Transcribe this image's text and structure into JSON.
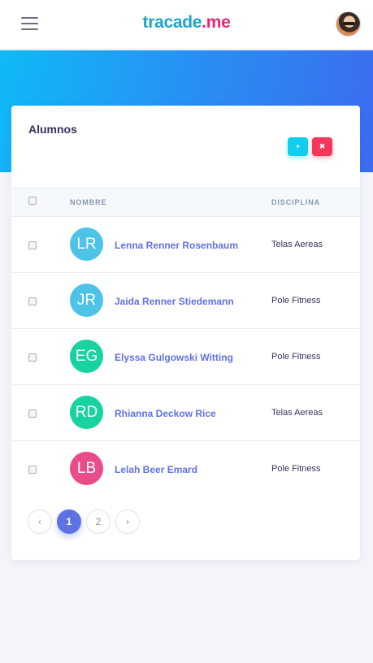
{
  "header": {
    "brand_part1": "tracade",
    "brand_part2": ".me"
  },
  "card": {
    "title": "Alumnos",
    "add_label": "+",
    "delete_label": "✖"
  },
  "table": {
    "columns": [
      "NOMBRE",
      "DISCIPLINA"
    ],
    "rows": [
      {
        "initials": "LR",
        "name": "Lenna Renner Rosenbaum",
        "discipline": "Telas Aereas",
        "color": "#4ec3e8"
      },
      {
        "initials": "JR",
        "name": "Jaida Renner Stiedemann",
        "discipline": "Pole Fitness",
        "color": "#4ec3e8"
      },
      {
        "initials": "EG",
        "name": "Elyssa Gulgowski Witting",
        "discipline": "Pole Fitness",
        "color": "#17d3a0"
      },
      {
        "initials": "RD",
        "name": "Rhianna Deckow Rice",
        "discipline": "Telas Aereas",
        "color": "#17d3a0"
      },
      {
        "initials": "LB",
        "name": "Lelah Beer Emard",
        "discipline": "Pole Fitness",
        "color": "#ea4c89"
      }
    ]
  },
  "pagination": {
    "prev": "‹",
    "pages": [
      "1",
      "2"
    ],
    "next": "›",
    "active_page": "1"
  },
  "colors": {
    "accent": "#5e72e4",
    "hero_start": "#0fb9f6",
    "hero_end": "#3b6cf0"
  }
}
